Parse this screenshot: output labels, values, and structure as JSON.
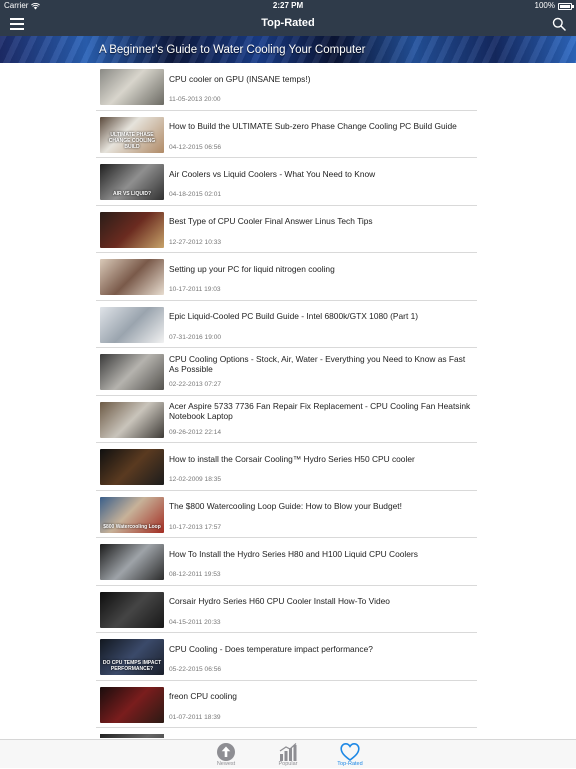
{
  "status_bar": {
    "carrier": "Carrier",
    "time": "2:27 PM",
    "battery": "100%"
  },
  "nav": {
    "title": "Top-Rated",
    "menu_icon": "hamburger-menu-icon",
    "search_icon": "search-icon"
  },
  "banner": {
    "title": "A Beginner's Guide to Water Cooling Your Computer"
  },
  "videos": [
    {
      "title": "CPU cooler on GPU (INSANE temps!)",
      "date": "11-05-2013 20:00",
      "thumb_text": ""
    },
    {
      "title": "How to Build the ULTIMATE Sub-zero Phase Change Cooling PC Build Guide",
      "date": "04-12-2015 06:56",
      "thumb_text": "ULTIMATE PHASE CHANGE COOLING BUILD"
    },
    {
      "title": "Air Coolers vs Liquid Coolers - What You Need to Know",
      "date": "04-18-2015 02:01",
      "thumb_text": "AIR VS LIQUID?"
    },
    {
      "title": "Best Type of CPU Cooler Final Answer Linus Tech Tips",
      "date": "12-27-2012 10:33",
      "thumb_text": ""
    },
    {
      "title": "Setting up your PC for liquid nitrogen cooling",
      "date": "10-17-2011 19:03",
      "thumb_text": ""
    },
    {
      "title": "Epic Liquid-Cooled PC Build Guide - Intel 6800k/GTX 1080 (Part 1)",
      "date": "07-31-2016 19:00",
      "thumb_text": ""
    },
    {
      "title": "CPU Cooling Options - Stock, Air, Water - Everything you Need to Know as Fast As Possible",
      "date": "02-22-2013 07:27",
      "thumb_text": ""
    },
    {
      "title": "Acer Aspire 5733 7736 Fan Repair Fix Replacement - CPU Cooling Fan Heatsink Notebook Laptop",
      "date": "09-26-2012 22:14",
      "thumb_text": ""
    },
    {
      "title": "How to install the Corsair Cooling™ Hydro Series H50 CPU cooler",
      "date": "12-02-2009 18:35",
      "thumb_text": ""
    },
    {
      "title": "The $800 Watercooling Loop Guide: How to Blow your Budget!",
      "date": "10-17-2013 17:57",
      "thumb_text": "$800 Watercooling Loop"
    },
    {
      "title": "How To Install the Hydro Series H80 and H100 Liquid CPU Coolers",
      "date": "08-12-2011 19:53",
      "thumb_text": ""
    },
    {
      "title": "Corsair Hydro Series H60 CPU Cooler Install How-To Video",
      "date": "04-15-2011 20:33",
      "thumb_text": ""
    },
    {
      "title": "CPU Cooling - Does temperature impact performance?",
      "date": "05-22-2015 06:56",
      "thumb_text": "DO CPU TEMPS IMPACT PERFORMANCE?"
    },
    {
      "title": "freon CPU cooling",
      "date": "01-07-2011 18:39",
      "thumb_text": ""
    }
  ],
  "tabs": [
    {
      "label": "Newest",
      "icon": "arrow-up-circle-icon",
      "active": false
    },
    {
      "label": "Popular",
      "icon": "bar-chart-icon",
      "active": false
    },
    {
      "label": "Top-Rated",
      "icon": "heart-icon",
      "active": true
    }
  ],
  "colors": {
    "nav_bg": "#2f3b4a",
    "active_tab": "#1e88e5",
    "inactive_tab": "#8e8e93"
  }
}
